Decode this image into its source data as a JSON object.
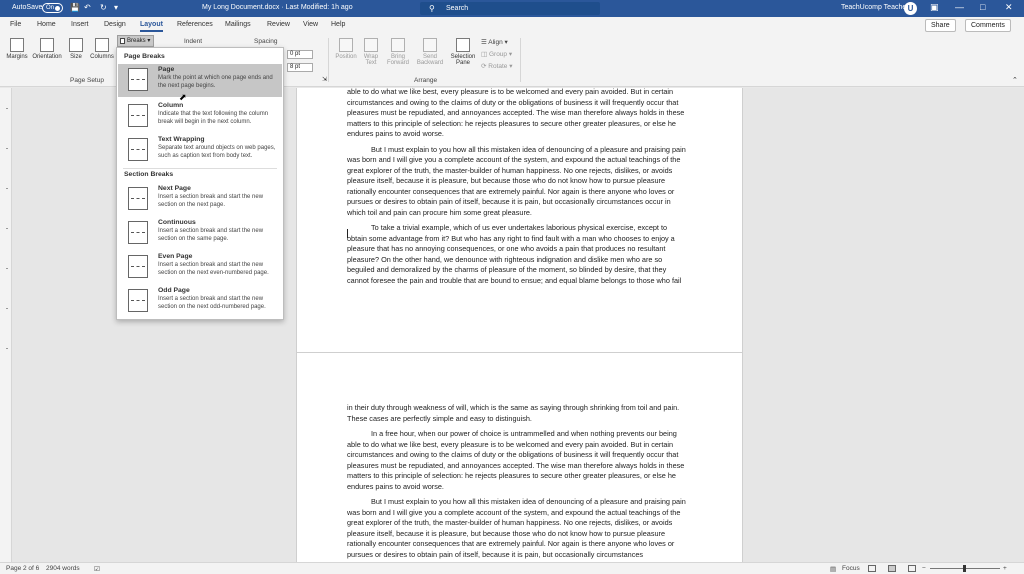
{
  "titlebar": {
    "autosave_label": "AutoSave",
    "autosave_state": "On",
    "doc_title": "My Long Document.docx  ·  Last Modified: 1h ago",
    "search_placeholder": "Search",
    "user_name": "TeachUcomp Teacher",
    "avatar_initial": "U"
  },
  "tabs": [
    "File",
    "Home",
    "Insert",
    "Design",
    "Layout",
    "References",
    "Mailings",
    "Review",
    "View",
    "Help"
  ],
  "active_tab": "Layout",
  "share_label": "Share",
  "comments_label": "Comments",
  "ribbon": {
    "margins": "Margins",
    "orientation": "Orientation",
    "size": "Size",
    "columns": "Columns",
    "breaks": "Breaks",
    "indent": "Indent",
    "spacing": "Spacing",
    "spacing_before": "0 pt",
    "spacing_after": "8 pt",
    "page_setup_group": "Page Setup",
    "position": "Position",
    "wrap_text": "Wrap Text",
    "bring_forward": "Bring Forward",
    "send_backward": "Send Backward",
    "selection_pane": "Selection Pane",
    "align": "Align",
    "group": "Group",
    "rotate": "Rotate",
    "arrange_group": "Arrange"
  },
  "dropdown": {
    "page_breaks_heading": "Page Breaks",
    "section_breaks_heading": "Section Breaks",
    "options": [
      {
        "title": "Page",
        "desc": "Mark the point at which one page ends and the next page begins."
      },
      {
        "title": "Column",
        "desc": "Indicate that the text following the column break will begin in the next column."
      },
      {
        "title": "Text Wrapping",
        "desc": "Separate text around objects on web pages, such as caption text from body text."
      },
      {
        "title": "Next Page",
        "desc": "Insert a section break and start the new section on the next page."
      },
      {
        "title": "Continuous",
        "desc": "Insert a section break and start the new section on the same page."
      },
      {
        "title": "Even Page",
        "desc": "Insert a section break and start the new section on the next even-numbered page."
      },
      {
        "title": "Odd Page",
        "desc": "Insert a section break and start the new section on the next odd-numbered page."
      }
    ]
  },
  "page1_paragraphs": [
    "able to do what we like best, every pleasure is to be welcomed and every pain avoided. But in certain circumstances and owing to the claims of duty or the obligations of business it will frequently occur that pleasures must be repudiated, and annoyances accepted. The wise man therefore always holds in these matters to this principle of selection: he rejects pleasures to secure other greater pleasures, or else he endures pains to avoid worse.",
    "But I must explain to you how all this mistaken idea of denouncing of a pleasure and praising pain was born and I will give you a complete account of the system, and expound the actual teachings of the great explorer of the truth, the master-builder of human happiness. No one rejects, dislikes, or avoids pleasure itself, because it is pleasure, but because those who do not know how to pursue pleasure rationally encounter consequences that are extremely painful. Nor again is there anyone who loves or pursues or desires to obtain pain of itself, because it is pain, but occasionally circumstances occur in which toil and pain can procure him some great pleasure.",
    "To take a trivial example, which of us ever undertakes laborious physical exercise, except to obtain some advantage from it? But who has any right to find fault with a man who chooses to enjoy a pleasure that has no annoying consequences, or one who avoids a pain that produces no resultant pleasure? On the other hand, we denounce with righteous indignation and dislike men who are so beguiled and demoralized by the charms of pleasure of the moment, so blinded by desire, that they cannot foresee the pain and trouble that are bound to ensue; and equal blame belongs to those who fail"
  ],
  "page2_paragraphs": [
    "in their duty through weakness of will, which is the same as saying through shrinking from toil and pain. These cases are perfectly simple and easy to distinguish.",
    "In a free hour, when our power of choice is untrammelled and when nothing prevents our being able to do what we like best, every pleasure is to be welcomed and every pain avoided. But in certain circumstances and owing to the claims of duty or the obligations of business it will frequently occur that pleasures must be repudiated, and annoyances accepted. The wise man therefore always holds in these matters to this principle of selection: he rejects pleasures to secure other greater pleasures, or else he endures pains to avoid worse.",
    "But I must explain to you how all this mistaken idea of denouncing of a pleasure and praising pain was born and I will give you a complete account of the system, and expound the actual teachings of the great explorer of the truth, the master-builder of human happiness. No one rejects, dislikes, or avoids pleasure itself, because it is pleasure, but because those who do not know how to pursue pleasure rationally encounter consequences that are extremely painful. Nor again is there anyone who loves or pursues or desires to obtain pain of itself, because it is pain, but occasionally circumstances"
  ],
  "statusbar": {
    "page": "Page 2 of 6",
    "words": "2904 words",
    "focus": "Focus"
  },
  "colors": {
    "accent": "#2b579a",
    "highlight": "#c6c6c6"
  }
}
